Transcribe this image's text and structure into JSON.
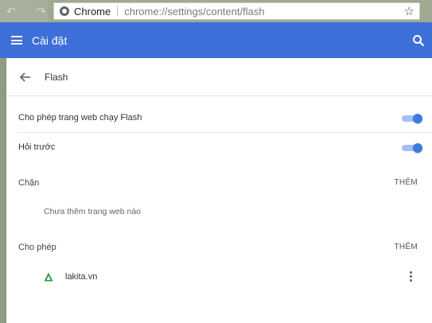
{
  "browser": {
    "scheme_label": "Chrome",
    "url": "chrome://settings/content/flash"
  },
  "header": {
    "title": "Cài đặt"
  },
  "page": {
    "title": "Flash"
  },
  "settings": {
    "allow_flash": {
      "label": "Cho phép trang web chạy Flash",
      "enabled": true
    },
    "ask_first": {
      "label": "Hỏi trước",
      "enabled": true
    }
  },
  "block_section": {
    "label": "Chặn",
    "add_label": "THÊM",
    "empty_text": "Chưa thêm trang web nào"
  },
  "allow_section": {
    "label": "Cho phép",
    "add_label": "THÊM",
    "sites": [
      {
        "name": "lakita.vn"
      }
    ]
  },
  "colors": {
    "header": "#3f6fd8",
    "toggle_on": "#3f7ae0"
  },
  "icons": [
    "site-info-icon",
    "bookmark-star-icon",
    "menu-icon",
    "search-icon",
    "back-arrow-icon",
    "site-favicon",
    "more-vert-icon"
  ]
}
